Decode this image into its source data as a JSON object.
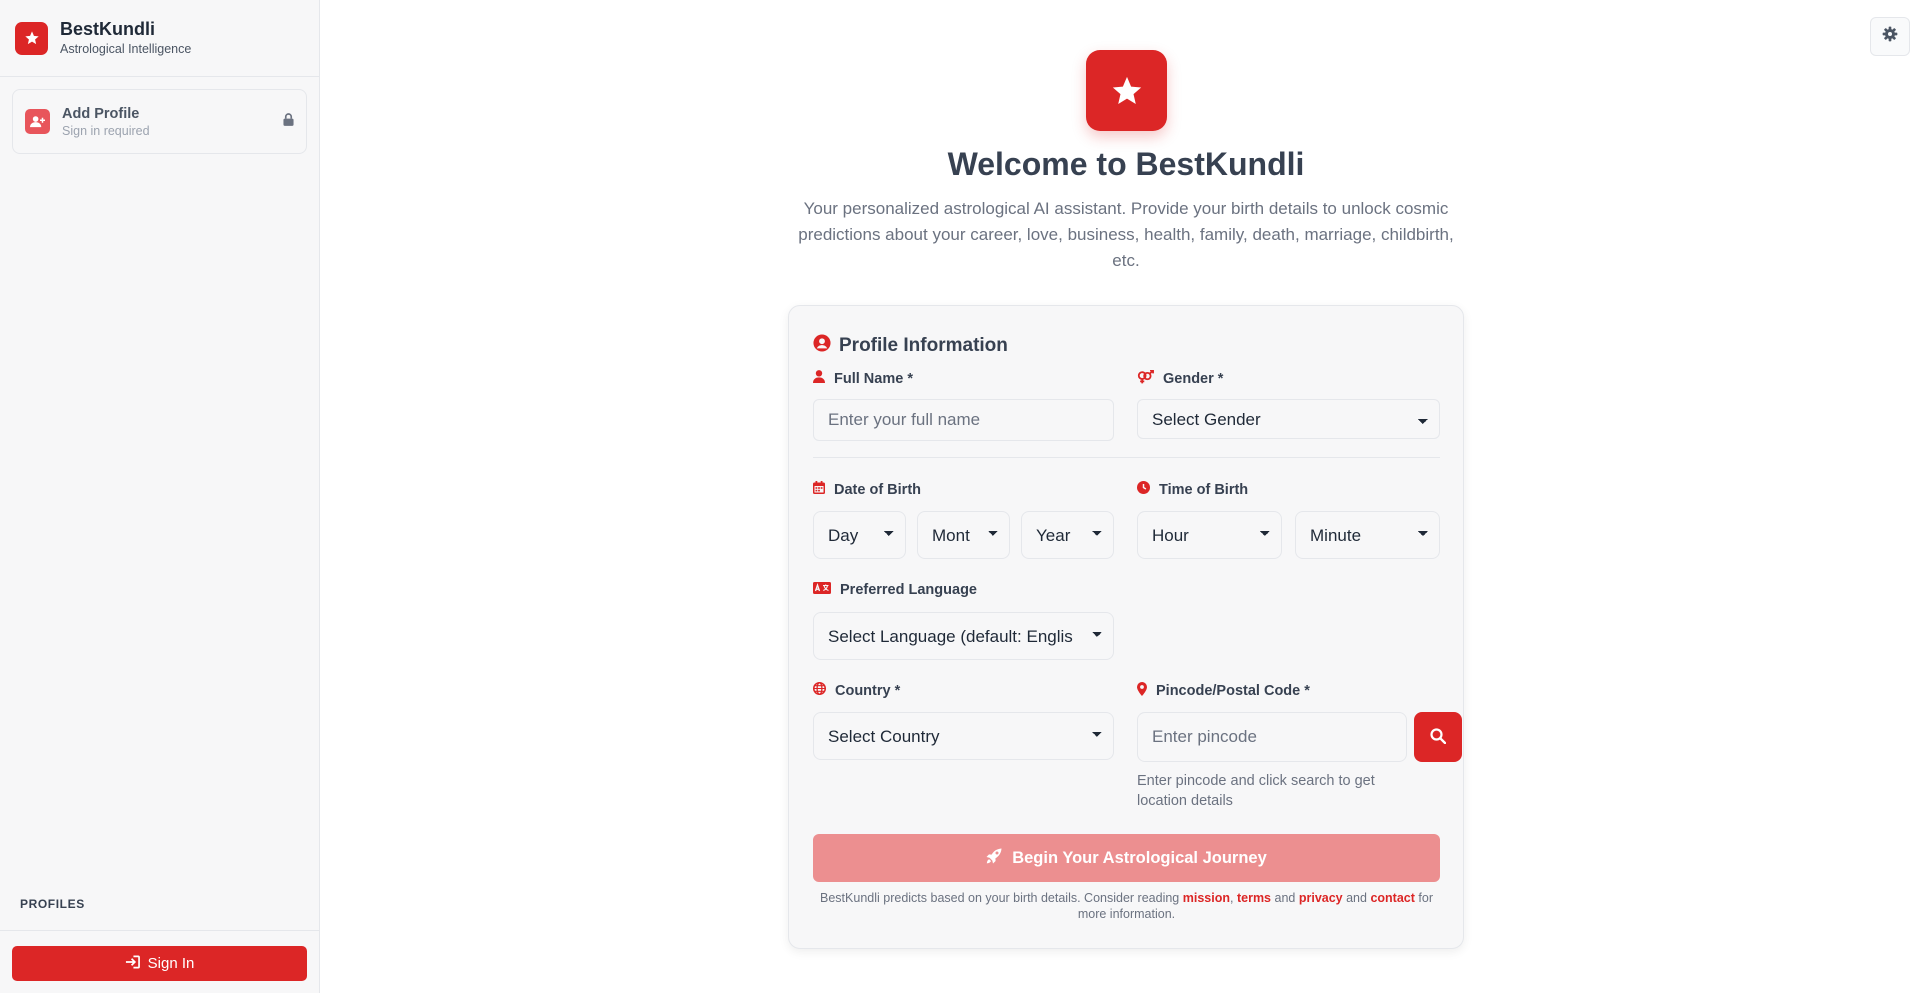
{
  "sidebar": {
    "brand_name": "BestKundli",
    "brand_sub": "Astrological Intelligence",
    "add_profile": {
      "title": "Add Profile",
      "subtitle": "Sign in required"
    },
    "profiles_label": "PROFILES",
    "signin_label": "Sign In"
  },
  "hero": {
    "title": "Welcome to BestKundli",
    "description": "Your personalized astrological AI assistant. Provide your birth details to unlock cosmic predictions about your career, love, business, health, family, death, marriage, childbirth, etc."
  },
  "form": {
    "title": "Profile Information",
    "full_name": {
      "label": "Full Name *",
      "placeholder": "Enter your full name"
    },
    "gender": {
      "label": "Gender *",
      "selected": "Select Gender"
    },
    "dob": {
      "label": "Date of Birth",
      "day": "Day",
      "month": "Mont",
      "year": "Year"
    },
    "tob": {
      "label": "Time of Birth",
      "hour": "Hour",
      "minute": "Minute"
    },
    "language": {
      "label": "Preferred Language",
      "selected": "Select Language (default: Englis"
    },
    "country": {
      "label": "Country *",
      "selected": "Select Country"
    },
    "pincode": {
      "label": "Pincode/Postal Code *",
      "placeholder": "Enter pincode",
      "hint": "Enter pincode and click search to get location details"
    },
    "submit_label": "Begin Your Astrological Journey",
    "footer": {
      "prefix": "BestKundli predicts based on your birth details. Consider reading",
      "mission": "mission",
      "comma": ",",
      "terms": "terms",
      "and1": "and",
      "privacy": "privacy",
      "and2": "and",
      "contact": "contact",
      "suffix": "for more information."
    }
  },
  "icons": {
    "brand": "star-icon",
    "add_profile": "user-plus-icon",
    "lock": "lock-icon",
    "sign_in": "sign-in-icon",
    "settings": "gear-icon",
    "profile": "user-circle-icon",
    "full_name": "user-icon",
    "gender": "venus-mars-icon",
    "dob": "calendar-icon",
    "tob": "clock-icon",
    "language": "language-icon",
    "country": "globe-icon",
    "pincode": "map-pin-icon",
    "search": "search-icon",
    "submit": "rocket-icon"
  },
  "colors": {
    "accent": "#dc2626",
    "accent_disabled": "#ec8f90",
    "text": "#374151",
    "muted": "#6b7280"
  }
}
